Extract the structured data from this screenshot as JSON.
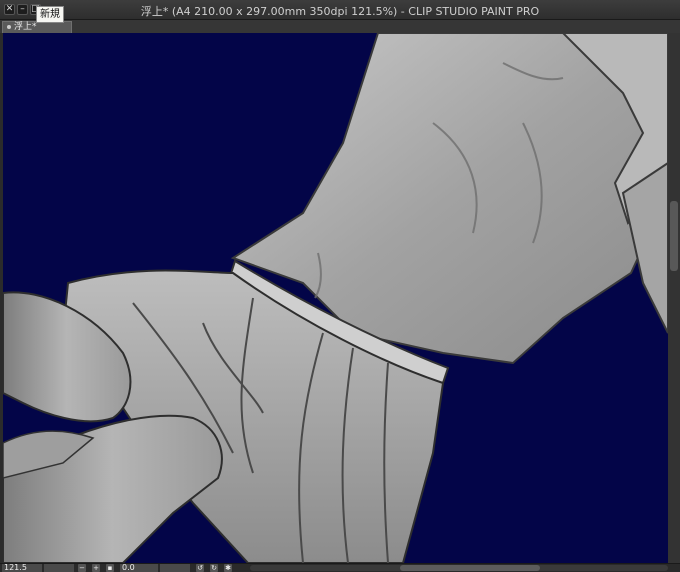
{
  "window": {
    "title": "浮上* (A4 210.00 x 297.00mm 350dpi 121.5%)  - CLIP STUDIO PAINT PRO",
    "close_glyph": "✕",
    "minimize_glyph": "–",
    "maximize_glyph": "□"
  },
  "tooltip": {
    "text": "新規"
  },
  "tabs": [
    {
      "label": "浮上*"
    }
  ],
  "status": {
    "zoom": "121.5",
    "rotation": "0.0"
  },
  "colors": {
    "canvas_background": "#030548",
    "figure_light": "#a8a8a8",
    "figure_dark": "#555555"
  },
  "icons": [
    "close-icon",
    "minimize-icon",
    "maximize-icon",
    "zoom-out-icon",
    "zoom-in-icon",
    "fit-icon",
    "rotate-left-icon",
    "rotate-right-icon",
    "reset-rotation-icon"
  ]
}
